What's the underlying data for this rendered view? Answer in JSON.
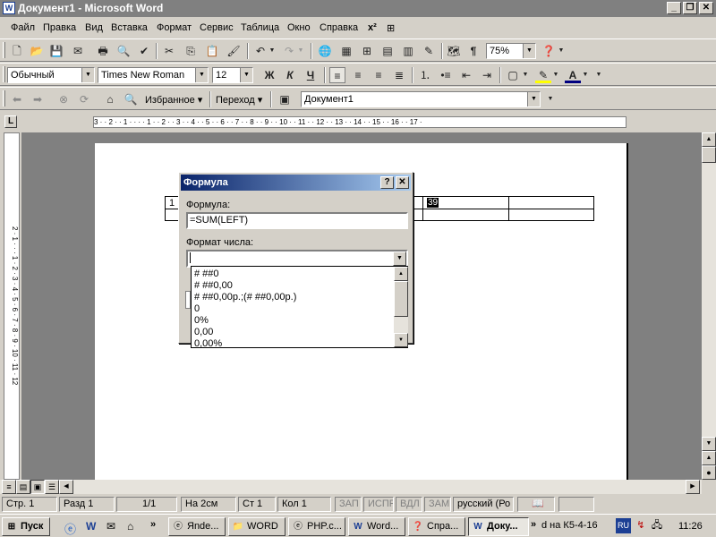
{
  "window": {
    "title": "Документ1 - Microsoft Word",
    "app_icon": "W"
  },
  "menu": [
    "Файл",
    "Правка",
    "Вид",
    "Вставка",
    "Формат",
    "Сервис",
    "Таблица",
    "Окно",
    "Справка"
  ],
  "format_bar": {
    "style": "Обычный",
    "font": "Times New Roman",
    "size": "12",
    "bold": "Ж",
    "italic": "К",
    "underline": "Ч",
    "font_color_letter": "A"
  },
  "standard_bar": {
    "zoom": "75%"
  },
  "web_bar": {
    "favorites": "Избранное",
    "goto": "Переход",
    "address": "Документ1"
  },
  "ruler": {
    "corner": "L",
    "text": "3 · · 2 · · 1 · · · · 1 · · 2 · · 3 · · 4 · · 5 · · 6 · · 7 · · 8 · · 9 · · 10 · · 11 · · 12 · · 13 · · 14 · · 15 · · 16 · · 17 ·"
  },
  "vruler": {
    "text": "2 · 1 · · · 1 · 2 · 3 · 4 · 5 · 6 · 7 · 8 · 9 · 10 · 11 · 12"
  },
  "table": {
    "cell_first": "1",
    "cell_sel": "39"
  },
  "dialog": {
    "title": "Формула",
    "help": "?",
    "close": "✕",
    "formula_label": "Формула:",
    "formula_value": "=SUM(LEFT)",
    "format_label": "Формат числа:",
    "format_value": "",
    "options": [
      "# ##0",
      "# ##0,00",
      "# ##0,00р.;(# ##0,00р.)",
      "0",
      "0%",
      "0,00",
      "0,00%"
    ]
  },
  "status": {
    "page": "Стр. 1",
    "section": "Разд 1",
    "pages": "1/1",
    "at": "На 2см",
    "line": "Ст 1",
    "col": "Кол 1",
    "rec": "ЗАП",
    "trk": "ИСПР",
    "ext": "ВДЛ",
    "ovr": "ЗАМ",
    "lang": "русский (Ро"
  },
  "taskbar": {
    "start": "Пуск",
    "items": [
      "Яnde...",
      "WORD",
      "PHP.c...",
      "Word...",
      "Спра...",
      "Доку..."
    ],
    "tray_text": "d на К5-4-16",
    "lang": "RU",
    "clock": "11:26"
  }
}
